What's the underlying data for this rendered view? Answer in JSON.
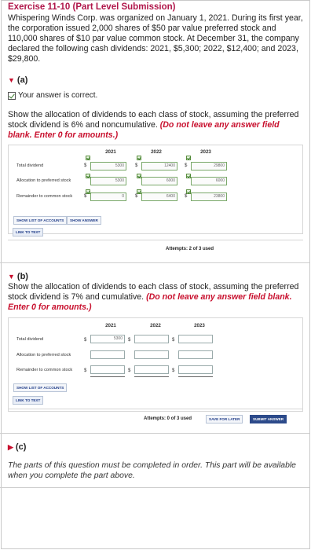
{
  "exercise": {
    "title": "Exercise 11-10 (Part Level Submission)",
    "text": "Whispering Winds Corp. was organized on January 1, 2021. During its first year, the corporation issued 2,000 shares of $50 par value preferred stock and 110,000 shares of $10 par value common stock. At December 31, the company declared the following cash dividends: 2021, $5,300; 2022, $12,400; and 2023, $29,800."
  },
  "part_a": {
    "label": "(a)",
    "correct_text": "Your answer is correct.",
    "instruction": "Show the allocation of dividends to each class of stock, assuming the preferred stock dividend is 6% and noncumulative.",
    "instruction_red": "(Do not leave any answer field blank. Enter 0 for amounts.)",
    "years": [
      "2021",
      "2022",
      "2023"
    ],
    "rows": [
      {
        "label": "Total dividend",
        "values": [
          "5300",
          "12400",
          "29800"
        ],
        "dollar": true
      },
      {
        "label": "Allocation to preferred stock",
        "values": [
          "5300",
          "6000",
          "6000"
        ],
        "dollar": false
      },
      {
        "label": "Remainder to common stock",
        "values": [
          "0",
          "6400",
          "23800"
        ],
        "dollar": true
      }
    ],
    "show_list": "SHOW LIST OF ACCOUNTS",
    "show_answer": "SHOW ANSWER",
    "link_to_text": "LINK TO TEXT",
    "attempts": "Attempts: 2 of 3 used"
  },
  "part_b": {
    "label": "(b)",
    "instruction": "Show the allocation of dividends to each class of stock, assuming the preferred stock dividend is 7% and cumulative.",
    "instruction_red": "(Do not leave any answer field blank. Enter 0 for amounts.)",
    "years": [
      "2021",
      "2022",
      "2023"
    ],
    "rows": [
      {
        "label": "Total dividend",
        "values": [
          "5300",
          "",
          ""
        ],
        "dollar": true
      },
      {
        "label": "Allocation to preferred stock",
        "values": [
          "",
          "",
          ""
        ],
        "dollar": false
      },
      {
        "label": "Remainder to common stock",
        "values": [
          "",
          "",
          ""
        ],
        "dollar": true
      }
    ],
    "show_list": "SHOW LIST OF ACCOUNTS",
    "link_to_text": "LINK TO TEXT",
    "attempts": "Attempts: 0 of 3 used",
    "save_later": "SAVE FOR LATER",
    "submit": "SUBMIT ANSWER"
  },
  "part_c": {
    "label": "(c)",
    "note": "The parts of this question must be completed in order. This part will be available when you complete the part above."
  }
}
